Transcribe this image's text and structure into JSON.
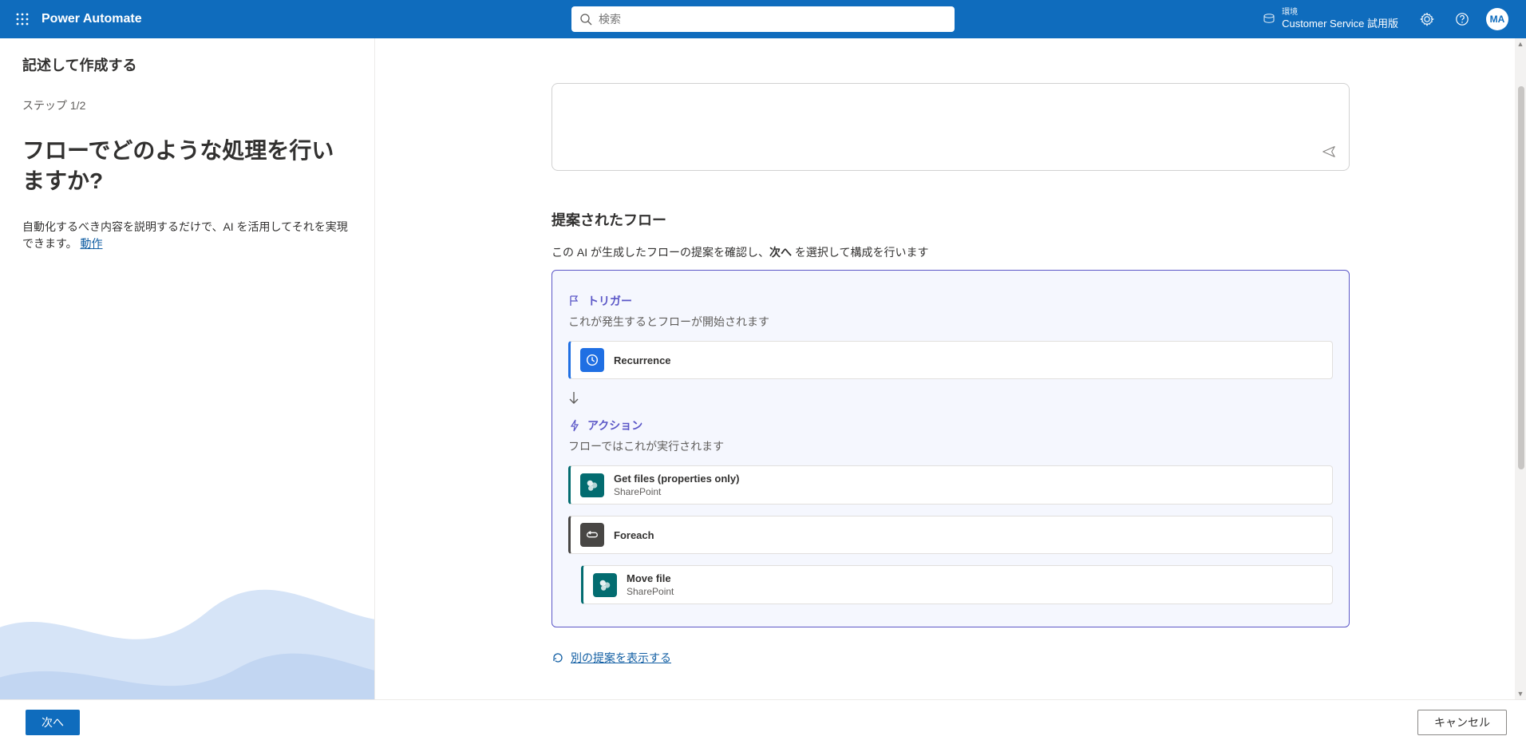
{
  "header": {
    "brand": "Power Automate",
    "search_placeholder": "検索",
    "env_label": "環境",
    "env_name": "Customer Service 試用版",
    "avatar_initials": "MA"
  },
  "page_title": "記述して作成する",
  "left": {
    "step_label": "ステップ 1/2",
    "heading": "フローでどのような処理を行いますか?",
    "desc_before_link": "自動化するべき内容を説明するだけで、AI を活用してそれを実現できます。 ",
    "link_text": "動作"
  },
  "suggested": {
    "title": "提案されたフロー",
    "subtitle_before": "この AI が生成したフローの提案を確認し、",
    "subtitle_bold": "次へ",
    "subtitle_after": " を選択して構成を行います",
    "trigger_label": "トリガー",
    "trigger_desc": "これが発生するとフローが開始されます",
    "trigger": {
      "title": "Recurrence",
      "brand_color": "#1f6fe3",
      "icon": "clock"
    },
    "action_label": "アクション",
    "action_desc": "フローではこれが実行されます",
    "actions": [
      {
        "title": "Get files (properties only)",
        "subtitle": "SharePoint",
        "brand_color": "#036c70",
        "icon": "sharepoint",
        "indent": 0
      },
      {
        "title": "Foreach",
        "subtitle": "",
        "brand_color": "#484644",
        "icon": "loop",
        "indent": 0
      },
      {
        "title": "Move file",
        "subtitle": "SharePoint",
        "brand_color": "#036c70",
        "icon": "sharepoint",
        "indent": 1
      }
    ],
    "alt_link": "別の提案を表示する"
  },
  "footer": {
    "next": "次へ",
    "cancel": "キャンセル"
  }
}
